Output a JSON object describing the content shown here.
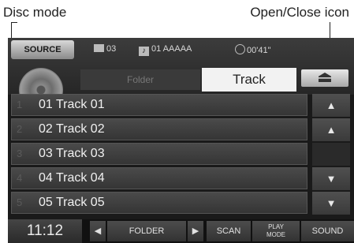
{
  "callouts": {
    "disc_mode": "Disc mode",
    "open_close": "Open/Close icon"
  },
  "top": {
    "source": "SOURCE",
    "folder_info": "03",
    "track_info": "01 AAAAA",
    "time": "00'41\""
  },
  "tabs": {
    "folder": "Folder",
    "track": "Track"
  },
  "tracks": [
    {
      "num": "1",
      "name": "01 Track 01"
    },
    {
      "num": "2",
      "name": "02 Track 02"
    },
    {
      "num": "3",
      "name": "03 Track 03"
    },
    {
      "num": "4",
      "name": "04 Track 04"
    },
    {
      "num": "5",
      "name": "05 Track 05"
    }
  ],
  "side_icons": [
    "double-up-arrow-icon",
    "up-arrow-icon",
    "down-arrow-icon",
    "double-down-arrow-icon"
  ],
  "bottom": {
    "clock": "11:12",
    "folder": "FOLDER",
    "scan": "SCAN",
    "play_mode_1": "PLAY",
    "play_mode_2": "MODE",
    "sound": "SOUND"
  }
}
